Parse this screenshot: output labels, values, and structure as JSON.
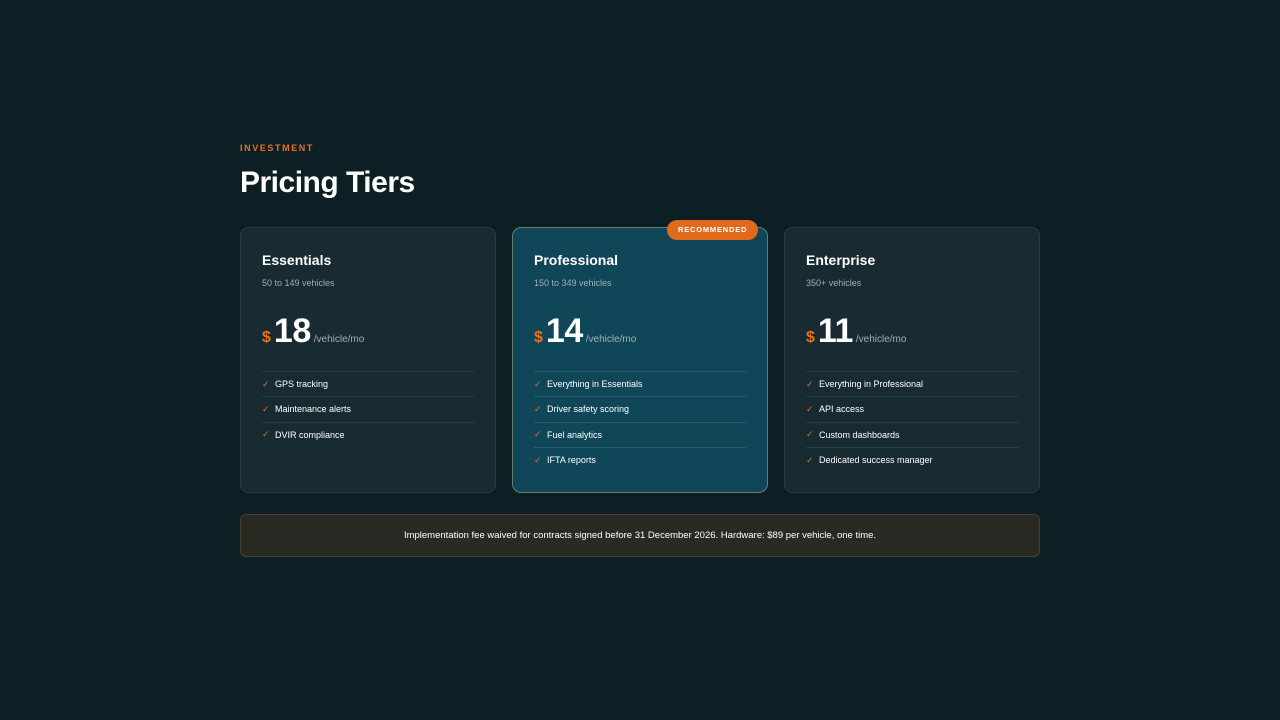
{
  "header": {
    "eyebrow": "INVESTMENT",
    "title": "Pricing Tiers"
  },
  "colors": {
    "background": "#0c1f25",
    "card": "#192b32",
    "featured_card": "#0f4758",
    "accent": "#e8701f",
    "muted_text": "#9fb0b4"
  },
  "tiers": [
    {
      "name": "Essentials",
      "range": "50 to 149 vehicles",
      "currency": "$",
      "price": "18",
      "unit": "/vehicle/mo",
      "features": [
        "GPS tracking",
        "Maintenance alerts",
        "DVIR compliance"
      ]
    },
    {
      "name": "Professional",
      "badge": "RECOMMENDED",
      "range": "150 to 349 vehicles",
      "currency": "$",
      "price": "14",
      "unit": "/vehicle/mo",
      "features": [
        "Everything in Essentials",
        "Driver safety scoring",
        "Fuel analytics",
        "IFTA reports"
      ]
    },
    {
      "name": "Enterprise",
      "range": "350+ vehicles",
      "currency": "$",
      "price": "11",
      "unit": "/vehicle/mo",
      "features": [
        "Everything in Professional",
        "API access",
        "Custom dashboards",
        "Dedicated success manager"
      ]
    }
  ],
  "icons": {
    "feature_check": "check-icon"
  },
  "footer_note": "Implementation fee waived for contracts signed before 31 December 2026. Hardware: $89 per vehicle, one time."
}
